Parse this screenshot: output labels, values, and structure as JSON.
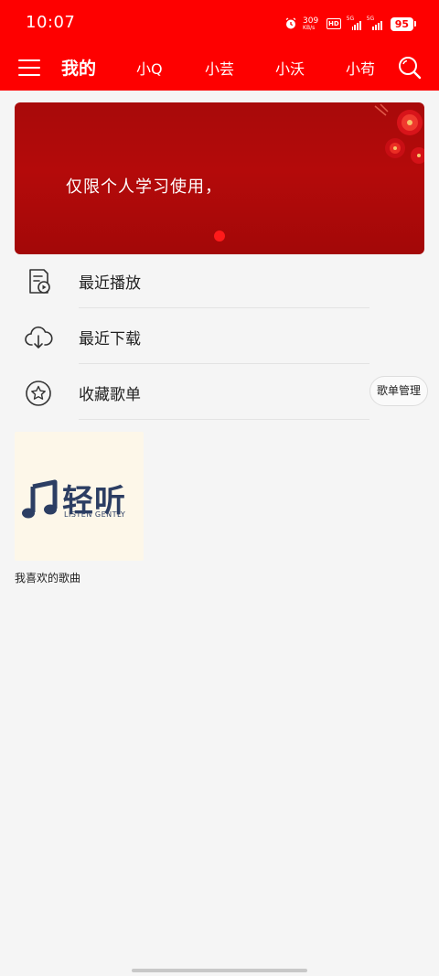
{
  "status_bar": {
    "time": "10:07",
    "net_speed": "309",
    "net_unit": "KB/s",
    "hd_label": "HD",
    "sig1_label": "5G",
    "sig2_label": "5G",
    "battery": "95"
  },
  "nav": {
    "tabs": [
      {
        "label": "我的"
      },
      {
        "label": "小Q"
      },
      {
        "label": "小芸"
      },
      {
        "label": "小沃"
      },
      {
        "label": "小苟"
      }
    ]
  },
  "banner": {
    "text": "仅限个人学习使用，"
  },
  "menu": {
    "items": [
      {
        "label": "最近播放",
        "icon": "recent-play-icon"
      },
      {
        "label": "最近下载",
        "icon": "cloud-download-icon"
      },
      {
        "label": "收藏歌单",
        "icon": "star-icon"
      }
    ],
    "manage_label": "歌单管理"
  },
  "playlists": [
    {
      "name": "我喜欢的歌曲",
      "logo_text": "轻听",
      "logo_sub": "LISTEN GENTLY"
    }
  ],
  "colors": {
    "header": "#fe0000",
    "banner": "#b00a0a",
    "logo": "#2c3e63"
  }
}
